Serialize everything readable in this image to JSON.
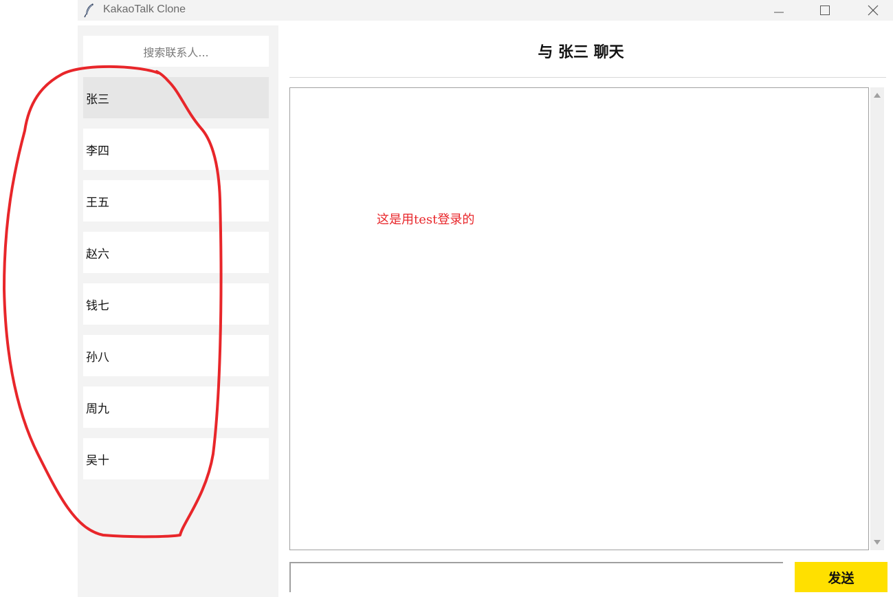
{
  "window": {
    "title": "KakaoTalk Clone",
    "icon": "feather-icon",
    "controls": [
      "minimize-icon",
      "maximize-icon",
      "close-icon"
    ]
  },
  "sidebar": {
    "search_placeholder": "搜索联系人...",
    "contacts": [
      {
        "name": "张三",
        "selected": true
      },
      {
        "name": "李四",
        "selected": false
      },
      {
        "name": "王五",
        "selected": false
      },
      {
        "name": "赵六",
        "selected": false
      },
      {
        "name": "钱七",
        "selected": false
      },
      {
        "name": "孙八",
        "selected": false
      },
      {
        "name": "周九",
        "selected": false
      },
      {
        "name": "吴十",
        "selected": false
      }
    ]
  },
  "chat": {
    "title": "与 张三 聊天",
    "messages": [],
    "input_value": "",
    "send_label": "发送"
  },
  "annotation": {
    "text": "这是用test登录的",
    "color": "#e8262a"
  },
  "colors": {
    "send_button": "#ffe000",
    "sidebar_background": "#f3f3f3",
    "selected_contact": "#e6e6e6"
  }
}
